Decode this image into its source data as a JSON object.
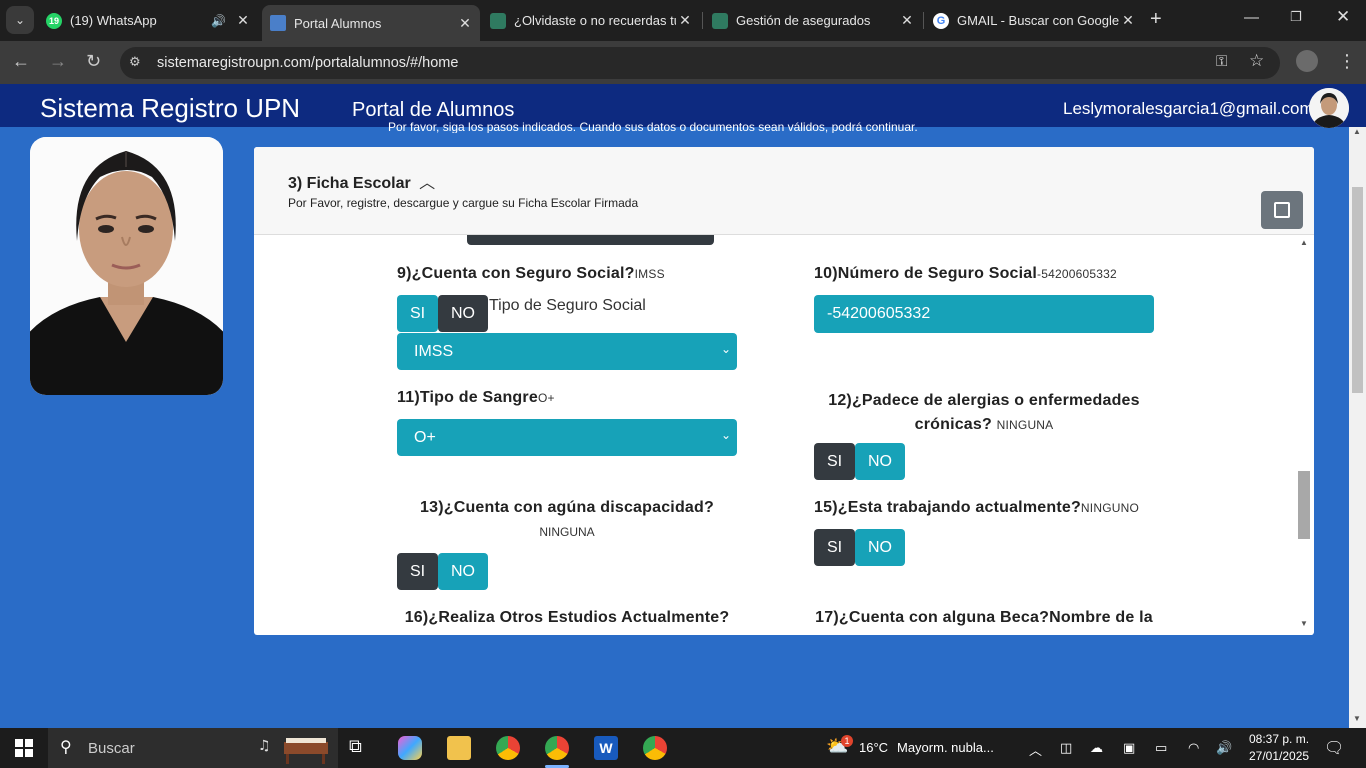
{
  "browser": {
    "tabs": [
      {
        "title": "(19) WhatsApp",
        "badge": "19",
        "icon": "whatsapp-icon",
        "audio": true
      },
      {
        "title": "Portal Alumnos",
        "icon": "portal-icon",
        "active": true
      },
      {
        "title": "¿Olvidaste o no recuerdas tu",
        "icon": "imss-icon"
      },
      {
        "title": "Gestión de asegurados",
        "icon": "imss-icon"
      },
      {
        "title": "GMAIL - Buscar con Google",
        "icon": "google-icon"
      }
    ],
    "url": "sistemaregistroupn.com/portalalumnos/#/home"
  },
  "header": {
    "brand": "Sistema Registro UPN",
    "portal": "Portal de Alumnos",
    "email": "Leslymoralesgarcia1@gmail.com"
  },
  "notice": "Por favor, siga los pasos indicados. Cuando sus datos o documentos sean válidos, podrá continuar.",
  "card": {
    "title": "3) Ficha Escolar",
    "subtitle": "Por Favor, registre, descargue y cargue su Ficha Escolar Firmada"
  },
  "form": {
    "q9": {
      "label": "9)¿Cuenta con Seguro Social?",
      "value": "IMSS",
      "si": "SI",
      "no": "NO",
      "tipo_label": "Tipo de Seguro Social",
      "select": "IMSS"
    },
    "q10": {
      "label": "10)Número de Seguro Social",
      "value": "-54200605332",
      "input": "-54200605332"
    },
    "q11": {
      "label": "11)Tipo de Sangre",
      "value": "O+",
      "select": "O+"
    },
    "q12": {
      "label_line1": "12)¿Padece de alergias o enfermedades",
      "label_line2": "crónicas?",
      "value": "NINGUNA",
      "si": "SI",
      "no": "NO"
    },
    "q13": {
      "label": "13)¿Cuenta con agúna discapacidad?",
      "value": "NINGUNA",
      "si": "SI",
      "no": "NO"
    },
    "q15": {
      "label": "15)¿Esta trabajando actualmente?",
      "value": "NINGUNO",
      "si": "SI",
      "no": "NO"
    },
    "q16": {
      "label": "16)¿Realiza Otros Estudios Actualmente?"
    },
    "q17": {
      "label": "17)¿Cuenta con alguna Beca?Nombre de la"
    }
  },
  "taskbar": {
    "search_placeholder": "Buscar",
    "weather": "16°C",
    "weather_desc": "Mayorm. nubla...",
    "weather_badge": "1",
    "time": "08:37 p. m.",
    "date": "27/01/2025"
  },
  "colors": {
    "teal": "#17a2b8",
    "dark": "#343a40",
    "header": "#0d2a80",
    "page": "#2a6cc7"
  }
}
